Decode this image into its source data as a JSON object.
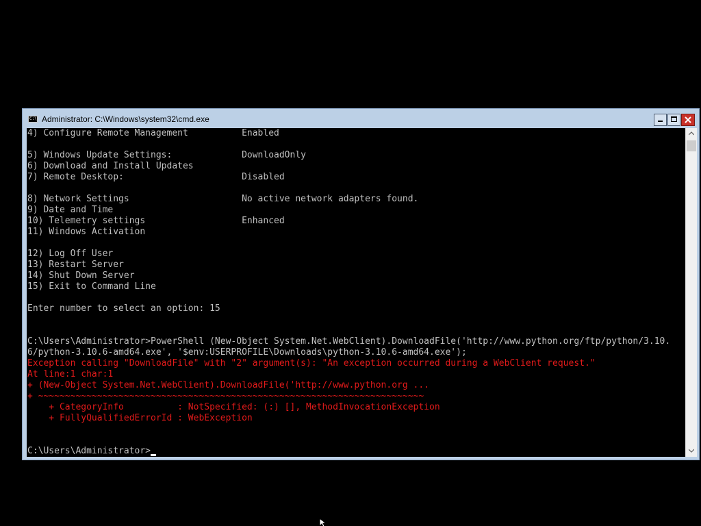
{
  "window": {
    "title": "Administrator: C:\\Windows\\system32\\cmd.exe",
    "icon_text": "C:\\"
  },
  "console": {
    "lines": [
      {
        "text": "4) Configure Remote Management          Enabled",
        "style": "normal"
      },
      {
        "text": "",
        "style": "normal"
      },
      {
        "text": "5) Windows Update Settings:             DownloadOnly",
        "style": "normal"
      },
      {
        "text": "6) Download and Install Updates",
        "style": "normal"
      },
      {
        "text": "7) Remote Desktop:                      Disabled",
        "style": "normal"
      },
      {
        "text": "",
        "style": "normal"
      },
      {
        "text": "8) Network Settings                     No active network adapters found.",
        "style": "normal"
      },
      {
        "text": "9) Date and Time",
        "style": "normal"
      },
      {
        "text": "10) Telemetry settings                  Enhanced",
        "style": "normal"
      },
      {
        "text": "11) Windows Activation",
        "style": "normal"
      },
      {
        "text": "",
        "style": "normal"
      },
      {
        "text": "12) Log Off User",
        "style": "normal"
      },
      {
        "text": "13) Restart Server",
        "style": "normal"
      },
      {
        "text": "14) Shut Down Server",
        "style": "normal"
      },
      {
        "text": "15) Exit to Command Line",
        "style": "normal"
      },
      {
        "text": "",
        "style": "normal"
      },
      {
        "text": "Enter number to select an option: 15",
        "style": "normal"
      },
      {
        "text": "",
        "style": "normal"
      },
      {
        "text": "",
        "style": "normal"
      },
      {
        "text": "C:\\Users\\Administrator>PowerShell (New-Object System.Net.WebClient).DownloadFile('http://www.python.org/ftp/python/3.10.",
        "style": "normal"
      },
      {
        "text": "6/python-3.10.6-amd64.exe', '$env:USERPROFILE\\Downloads\\python-3.10.6-amd64.exe');",
        "style": "normal"
      },
      {
        "text": "Exception calling \"DownloadFile\" with \"2\" argument(s): \"An exception occurred during a WebClient request.\"",
        "style": "error"
      },
      {
        "text": "At line:1 char:1",
        "style": "error"
      },
      {
        "text": "+ (New-Object System.Net.WebClient).DownloadFile('http://www.python.org ...",
        "style": "error"
      },
      {
        "text": "+ ~~~~~~~~~~~~~~~~~~~~~~~~~~~~~~~~~~~~~~~~~~~~~~~~~~~~~~~~~~~~~~~~~~~~~~~~",
        "style": "error"
      },
      {
        "text": "    + CategoryInfo          : NotSpecified: (:) [], MethodInvocationException",
        "style": "error"
      },
      {
        "text": "    + FullyQualifiedErrorId : WebException",
        "style": "error"
      },
      {
        "text": "",
        "style": "normal"
      },
      {
        "text": "",
        "style": "normal"
      },
      {
        "text": "C:\\Users\\Administrator>",
        "style": "prompt"
      }
    ]
  },
  "colors": {
    "console_background": "#000000",
    "normal_text": "#c0c0c0",
    "error_text": "#e01a1a",
    "titlebar": "#bcd0e6",
    "close_button": "#c8312a"
  }
}
